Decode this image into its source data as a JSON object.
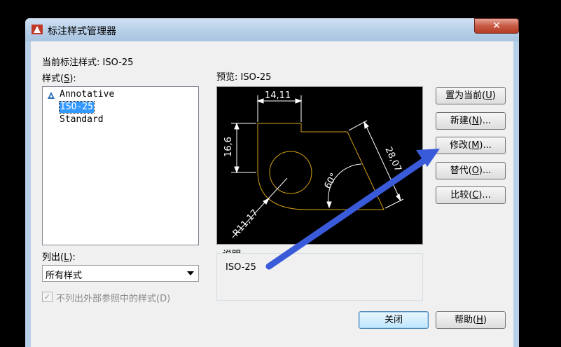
{
  "window": {
    "title": "标注样式管理器",
    "close_label": "✕"
  },
  "current_style": "当前标注样式: ISO-25",
  "styles_label_pre": "样式(",
  "styles_label_key": "S",
  "styles_label_post": "):",
  "styles": [
    {
      "label": "Annotative",
      "icon": "annotative-icon",
      "selected": false
    },
    {
      "label": "ISO-25",
      "icon": "",
      "selected": true
    },
    {
      "label": "Standard",
      "icon": "",
      "selected": false
    }
  ],
  "list_label_pre": "列出(",
  "list_label_key": "L",
  "list_label_post": "):",
  "list_value": "所有样式",
  "exclude_xref_label": "不列出外部参照中的样式(D)",
  "exclude_xref_checked": true,
  "preview_label": "预览: ISO-25",
  "preview_dims": {
    "top": "14,11",
    "left": "16,6",
    "diag": "28,07",
    "angle": "60°",
    "radius": "R11,17"
  },
  "description_label": "说明",
  "description_value": "ISO-25",
  "buttons": {
    "set_current": {
      "pre": "置为当前(",
      "key": "U",
      "post": ")"
    },
    "new": {
      "pre": "新建(",
      "key": "N",
      "post": ")..."
    },
    "modify": {
      "pre": "修改(",
      "key": "M",
      "post": ")..."
    },
    "override": {
      "pre": "替代(",
      "key": "O",
      "post": ")..."
    },
    "compare": {
      "pre": "比较(",
      "key": "C",
      "post": ")..."
    },
    "close": "关闭",
    "help": {
      "pre": "帮助(",
      "key": "H",
      "post": ")"
    }
  },
  "colors": {
    "arrow": "#3a5bd9",
    "preview_bg": "#000000",
    "geometry": "#d4a017",
    "selection": "#3399ff"
  }
}
